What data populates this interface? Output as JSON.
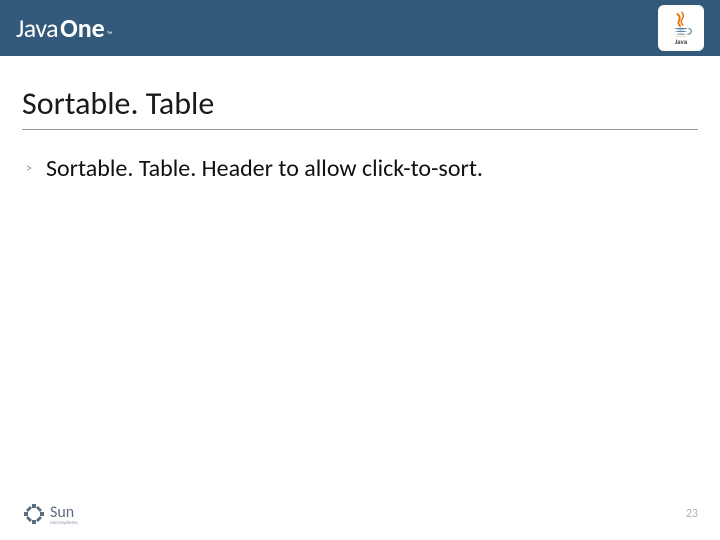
{
  "header": {
    "logo_left": "Java",
    "logo_right": "One",
    "tm": "™",
    "java_label": "Java"
  },
  "slide": {
    "title": "Sortable. Table",
    "bullet_marker": ">",
    "bullet_text": "Sortable. Table. Header to allow click-to-sort."
  },
  "footer": {
    "sun_text": "Sun",
    "sun_sub": "microsystems",
    "page_number": "23"
  }
}
